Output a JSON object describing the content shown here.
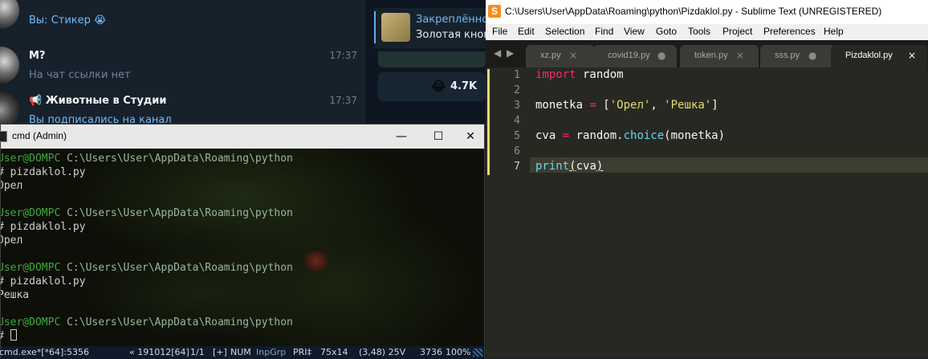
{
  "telegram": {
    "chats": [
      {
        "name": "",
        "time": "",
        "preview": "Вы: Стикер 😭"
      },
      {
        "name": "M?",
        "time": "17:37",
        "preview": "На чат ссылки нет"
      },
      {
        "name": "📢 Животные в Студии",
        "time": "17:37",
        "preview": "Вы подписались на канал"
      }
    ],
    "pinned": {
      "title": "Закреплённо",
      "text": "Золотая кноп"
    },
    "reaction": {
      "emoji": "😂",
      "count": "4.7K"
    }
  },
  "cmd": {
    "title": "cmd (Admin)",
    "controls": {
      "minimize": "—",
      "maximize": "☐",
      "close": "✕"
    },
    "blocks": [
      {
        "user": "User@DOMPC",
        "path": "C:\\Users\\User\\AppData\\Roaming\\python",
        "command": "# pizdaklol.py",
        "output": "Орел"
      },
      {
        "user": "User@DOMPC",
        "path": "C:\\Users\\User\\AppData\\Roaming\\python",
        "command": "# pizdaklol.py",
        "output": "Орел"
      },
      {
        "user": "User@DOMPC",
        "path": "C:\\Users\\User\\AppData\\Roaming\\python",
        "command": "# pizdaklol.py",
        "output": "Решка"
      },
      {
        "user": "User@DOMPC",
        "path": "C:\\Users\\User\\AppData\\Roaming\\python",
        "command": "# ",
        "output": ""
      }
    ],
    "status": {
      "process": "cmd.exe*[*64]:5356",
      "build": "« 191012[64]",
      "pos": "1/1",
      "plus": "[+]",
      "num": "NUM",
      "inp": "InpGrp",
      "pri": "PRI‡",
      "size": "75x14",
      "coords": "(3,48) 25V",
      "pid": "3736",
      "zoom": "100%"
    }
  },
  "sublime": {
    "title": "C:\\Users\\User\\AppData\\Roaming\\python\\Pizdaklol.py - Sublime Text (UNREGISTERED)",
    "menu": [
      "File",
      "Edit",
      "Selection",
      "Find",
      "View",
      "Goto",
      "Tools",
      "Project",
      "Preferences",
      "Help"
    ],
    "tabs": [
      {
        "label": "xz.py",
        "mark": "×"
      },
      {
        "label": "covid19.py",
        "mark": "●"
      },
      {
        "label": "token.py",
        "mark": "×"
      },
      {
        "label": "sss.py",
        "mark": "●"
      },
      {
        "label": "Pizdaklol.py",
        "mark": "×"
      }
    ],
    "lines": [
      "1",
      "2",
      "3",
      "4",
      "5",
      "6",
      "7"
    ],
    "code": {
      "l1_kw": "import",
      "l1_rest": " random",
      "l3_var": "monetka ",
      "l3_op": "=",
      "l3_open": " [",
      "l3_s1": "'Орел'",
      "l3_comma": ", ",
      "l3_s2": "'Решка'",
      "l3_close": "]",
      "l5_var": "cva ",
      "l5_op": "=",
      "l5_mid": " random.",
      "l5_fn": "choice",
      "l5_args": "(monetka)",
      "l7_fn": "print",
      "l7_open": "(",
      "l7_arg": "cva",
      "l7_close": ")"
    }
  },
  "colors": {
    "terminal_user": "#3fa93f",
    "monokai_bg": "#272822",
    "keyword": "#f92672",
    "string": "#e6db74",
    "function": "#66d9ef"
  }
}
